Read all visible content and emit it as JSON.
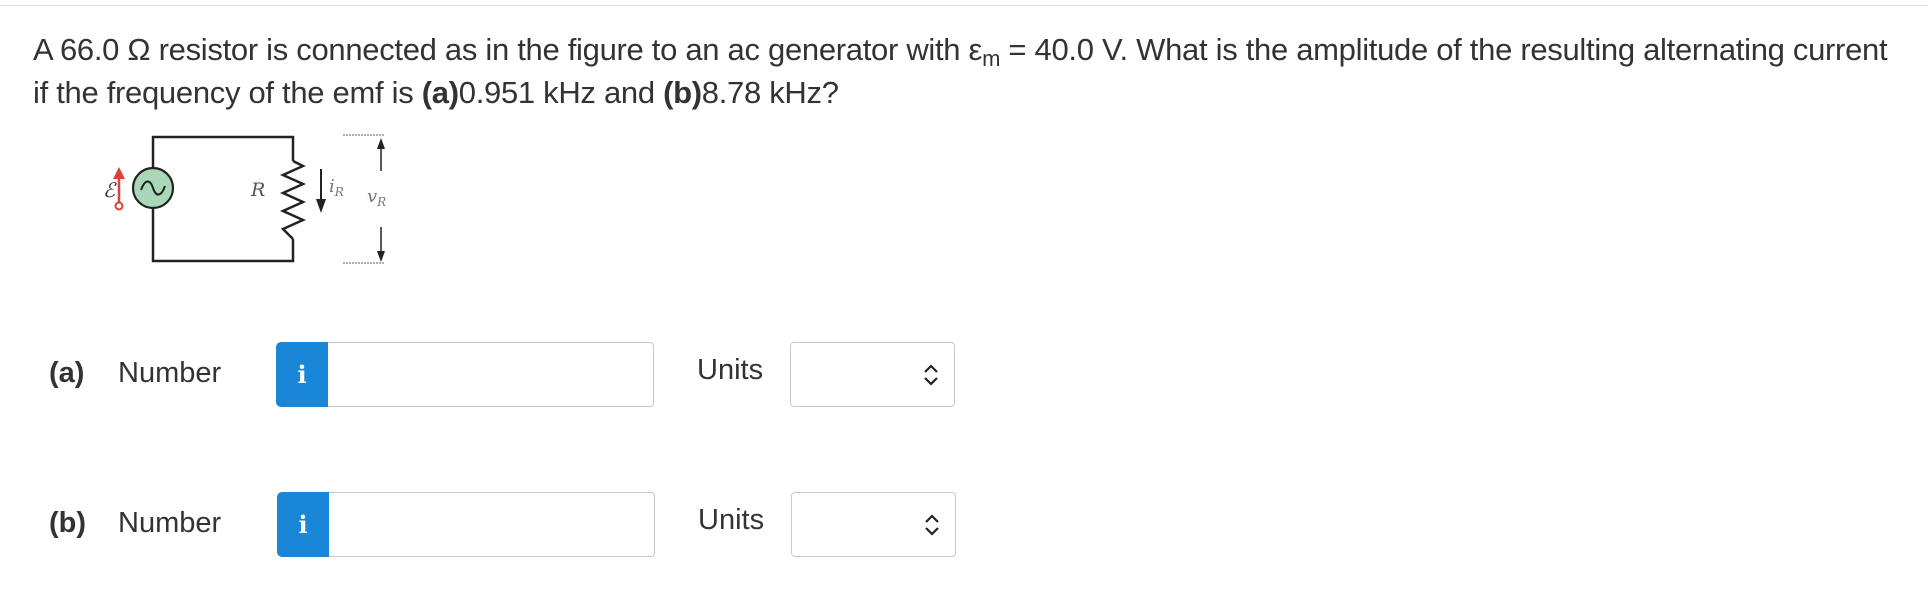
{
  "question": {
    "p1": "A 66.0 Ω resistor is connected as in the figure to an ac generator with ε",
    "sub": "m",
    "p2": " = 40.0 V. What is the amplitude of the resulting alternating current if the frequency of the emf is ",
    "a_tag": "(a)",
    "a_val": "0.951 kHz and ",
    "b_tag": "(b)",
    "b_val": "8.78 kHz?"
  },
  "figure": {
    "emf_symbol": "ℰ",
    "resistor_label": "R",
    "current_label": "i",
    "current_sub": "R",
    "voltage_label": "v",
    "voltage_sub": "R",
    "source_color": "#a8d8b8",
    "arrow_color": "#d9433a"
  },
  "parts": [
    {
      "tag": "(a)",
      "number_label": "Number",
      "info_icon": "i",
      "value": "",
      "units_label": "Units",
      "units_value": ""
    },
    {
      "tag": "(b)",
      "number_label": "Number",
      "info_icon": "i",
      "value": "",
      "units_label": "Units",
      "units_value": ""
    }
  ],
  "colors": {
    "info_button": "#1a86d8"
  }
}
